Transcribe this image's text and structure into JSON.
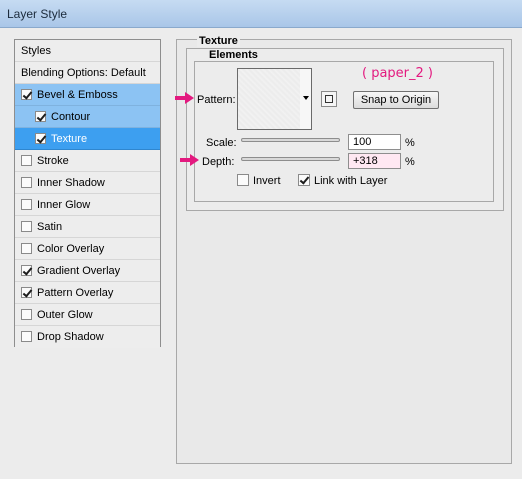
{
  "window": {
    "title": "Layer Style"
  },
  "styles_panel": {
    "header": "Styles",
    "blending_options": "Blending Options: Default",
    "items": [
      {
        "label": "Bevel & Emboss",
        "checked": true
      },
      {
        "label": "Contour",
        "checked": true
      },
      {
        "label": "Texture",
        "checked": true
      },
      {
        "label": "Stroke",
        "checked": false
      },
      {
        "label": "Inner Shadow",
        "checked": false
      },
      {
        "label": "Inner Glow",
        "checked": false
      },
      {
        "label": "Satin",
        "checked": false
      },
      {
        "label": "Color Overlay",
        "checked": false
      },
      {
        "label": "Gradient Overlay",
        "checked": true
      },
      {
        "label": "Pattern Overlay",
        "checked": true
      },
      {
        "label": "Outer Glow",
        "checked": false
      },
      {
        "label": "Drop Shadow",
        "checked": false
      }
    ]
  },
  "texture": {
    "group_title": "Texture",
    "elements_title": "Elements",
    "pattern_label": "Pattern:",
    "annotation": "( paper_2 )",
    "snap_button": "Snap to Origin",
    "scale_label": "Scale:",
    "scale_value": "100",
    "scale_unit": "%",
    "scale_level": 100,
    "depth_label": "Depth:",
    "depth_value": "+318",
    "depth_unit": "%",
    "depth_level": 318,
    "invert_label": "Invert",
    "invert_checked": false,
    "link_label": "Link with Layer",
    "link_checked": true
  },
  "colors": {
    "selected_row": "#8cc3f3",
    "active_row": "#3d9ff0",
    "annotation": "#e3197f"
  },
  "icons": {
    "pattern_dropdown": "chevron-down-icon",
    "new_preset": "new-preset-icon",
    "arrow": "pink-arrow-icon"
  }
}
